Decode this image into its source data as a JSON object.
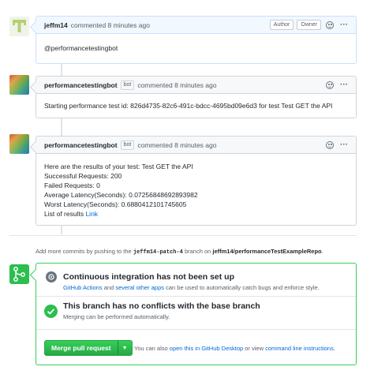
{
  "comments": [
    {
      "author": "jeffm14",
      "meta": "commented 8 minutes ago",
      "badges": [
        "Author",
        "Owner"
      ],
      "body": [
        "@performancetestingbot"
      ]
    },
    {
      "author": "performancetestingbot",
      "bot_badge": "bot",
      "meta": "commented 8 minutes ago",
      "body": [
        "Starting performance test id: 826d4735-82c6-491c-bdcc-4695bd09e6d3 for test Test GET the API"
      ]
    },
    {
      "author": "performancetestingbot",
      "bot_badge": "bot",
      "meta": "commented 8 minutes ago",
      "body": [
        "Here are the results of your test: Test GET the API",
        "Successful Requests: 200",
        "Failed Requests: 0",
        "Average Latency(Seconds): 0.07256848692893982",
        "Worst Latency(Seconds): 0.6880412101745605"
      ],
      "results_prefix": "List of results",
      "results_link": "Link"
    }
  ],
  "push_note": {
    "prefix": "Add more commits by pushing to the",
    "branch": "jeffm14-patch-4",
    "middle": "branch on",
    "repo": "jeffm14/performanceTestExampleRepo",
    "suffix": "."
  },
  "merge": {
    "ci_title": "Continuous integration has not been set up",
    "ci_link1": "GitHub Actions",
    "ci_and": "and",
    "ci_link2": "several other apps",
    "ci_rest": "can be used to automatically catch bugs and enforce style.",
    "conflict_title": "This branch has no conflicts with the base branch",
    "conflict_sub": "Merging can be performed automatically.",
    "button_label": "Merge pull request",
    "hint_prefix": "You can also",
    "hint_link1": "open this in GitHub Desktop",
    "hint_or": "or view",
    "hint_link2": "command line instructions",
    "hint_suffix": "."
  },
  "colors": {
    "accent_green": "#2cbe4e",
    "link_blue": "#0366d6",
    "border": "#d1d5da"
  },
  "icons": [
    "emoji-icon",
    "more-icon",
    "merge-icon",
    "ci-icon",
    "check-icon",
    "dropdown-caret-icon"
  ]
}
